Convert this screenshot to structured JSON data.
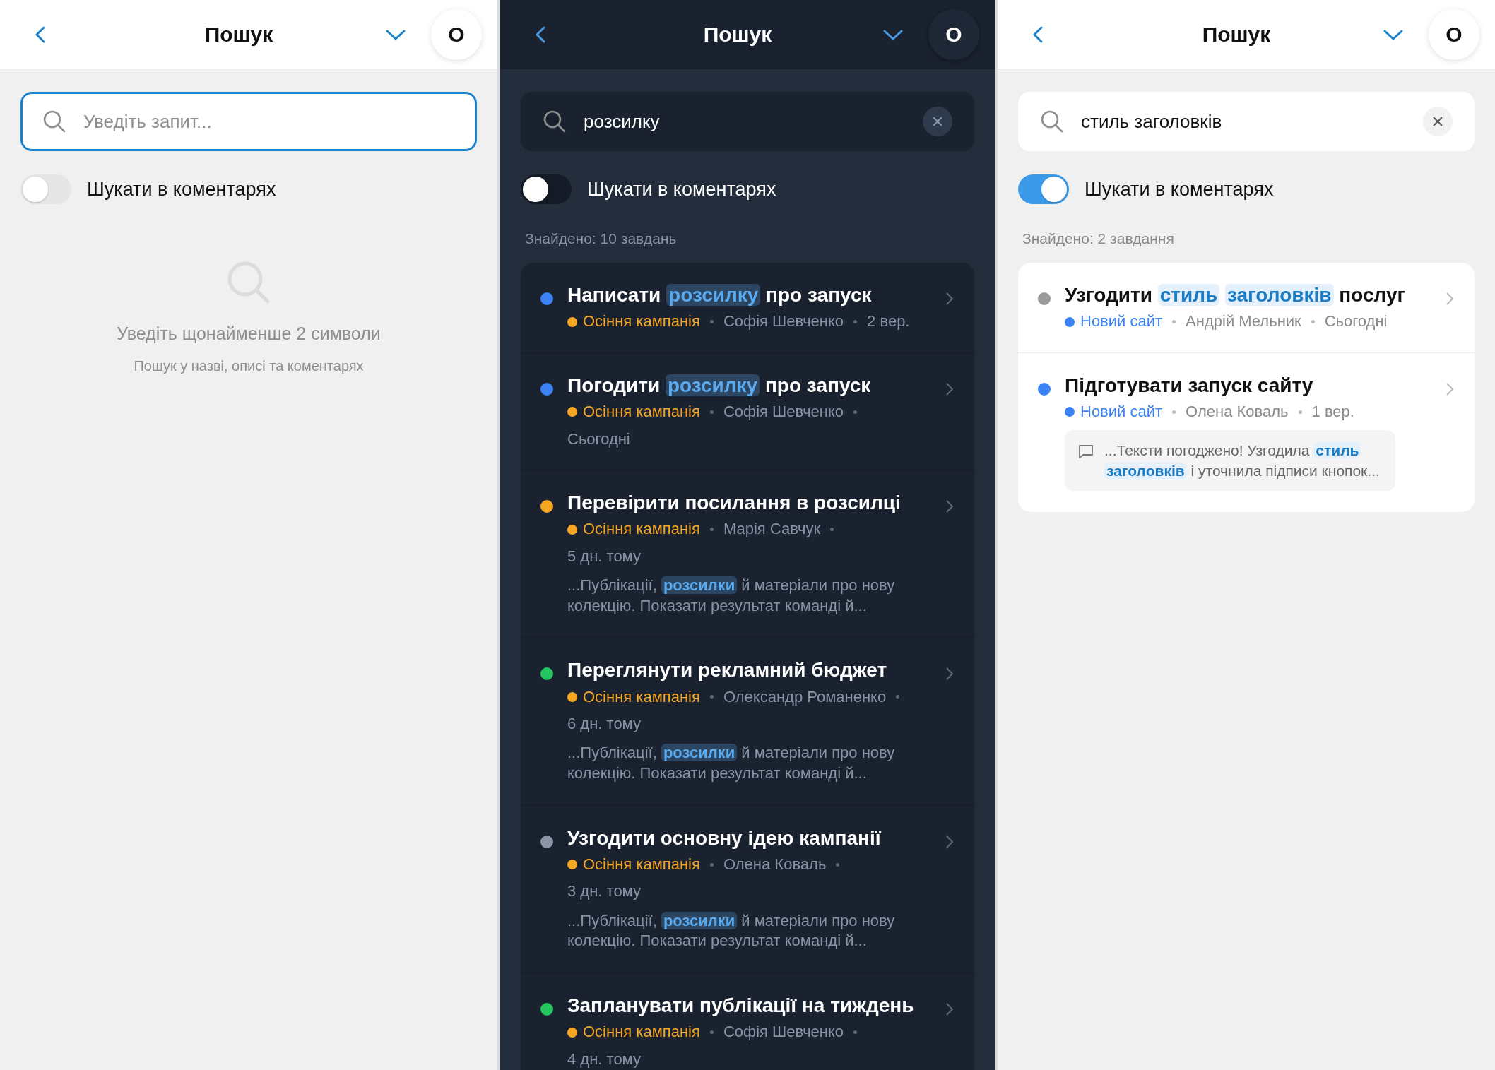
{
  "panels": [
    {
      "dark": false,
      "header": {
        "title": "Пошук",
        "avatar": "О"
      },
      "search": {
        "placeholder": "Уведіть запит...",
        "focused": true
      },
      "comments_toggle": {
        "label": "Шукати в коментарях",
        "on": false
      },
      "empty_state": {
        "title": "Уведіть щонайменше 2 символи",
        "hint": "Пошук у назві, описі та коментарях"
      }
    },
    {
      "dark": true,
      "header": {
        "title": "Пошук",
        "avatar": "О"
      },
      "search": {
        "value": "розсилку",
        "focused": false
      },
      "comments_toggle": {
        "label": "Шукати в коментарях",
        "on": false
      },
      "count": "Знайдено: 10 завдань",
      "results": [
        {
          "title": "Написати **розсилку** про запуск",
          "color": "#3b82f6",
          "project": {
            "name": "Осіння кампанія",
            "color": "#f5a623"
          },
          "author": "Софія Шевченко",
          "date": "2 вер."
        },
        {
          "title": "Погодити **розсилку** про запуск",
          "color": "#3b82f6",
          "project": {
            "name": "Осіння кампанія",
            "color": "#f5a623"
          },
          "author": "Софія Шевченко",
          "date": "Сьогодні"
        },
        {
          "title": "Перевірити посилання в розсилці",
          "color": "#f5a623",
          "project": {
            "name": "Осіння кампанія",
            "color": "#f5a623"
          },
          "author": "Марія Савчук",
          "date": "5 дн. тому",
          "snippet": {
            "kind": "description",
            "text": "...Публікації, **розсилки** й матеріали про нову колекцію. Показати результат команді й..."
          }
        },
        {
          "title": "Переглянути рекламний бюджет",
          "color": "#22c55e",
          "project": {
            "name": "Осіння кампанія",
            "color": "#f5a623"
          },
          "author": "Олександр Романенко",
          "date": "6 дн. тому",
          "snippet": {
            "kind": "description",
            "text": "...Публікації, **розсилки** й матеріали про нову колекцію. Показати результат команді й..."
          }
        },
        {
          "title": "Узгодити основну ідею кампанії",
          "color": "#8a94a6",
          "project": {
            "name": "Осіння кампанія",
            "color": "#f5a623"
          },
          "author": "Олена Коваль",
          "date": "3 дн. тому",
          "snippet": {
            "kind": "description",
            "text": "...Публікації, **розсилки** й матеріали про нову колекцію. Показати результат команді й..."
          }
        },
        {
          "title": "Запланувати публікації на тиждень",
          "color": "#22c55e",
          "project": {
            "name": "Осіння кампанія",
            "color": "#f5a623"
          },
          "author": "Софія Шевченко",
          "date": "4 дн. тому"
        }
      ]
    },
    {
      "dark": false,
      "header": {
        "title": "Пошук",
        "avatar": "О"
      },
      "search": {
        "value": "стиль заголовків",
        "focused": false
      },
      "comments_toggle": {
        "label": "Шукати в коментарях",
        "on": true
      },
      "count": "Знайдено: 2 завдання",
      "results": [
        {
          "title": "Узгодити **стиль** **заголовків** послуг",
          "color": "#9a9a9a",
          "project": {
            "name": "Новий сайт",
            "color": "#3b82f6"
          },
          "author": "Андрій Мельник",
          "date": "Сьогодні"
        },
        {
          "title": "Підготувати запуск сайту",
          "color": "#3b82f6",
          "project": {
            "name": "Новий сайт",
            "color": "#3b82f6"
          },
          "author": "Олена Коваль",
          "date": "1 вер.",
          "snippet": {
            "kind": "comment",
            "text": "...Тексти погоджено! Узгодила **стиль** **заголовків** і уточнила підписи кнопок..."
          }
        }
      ]
    }
  ]
}
